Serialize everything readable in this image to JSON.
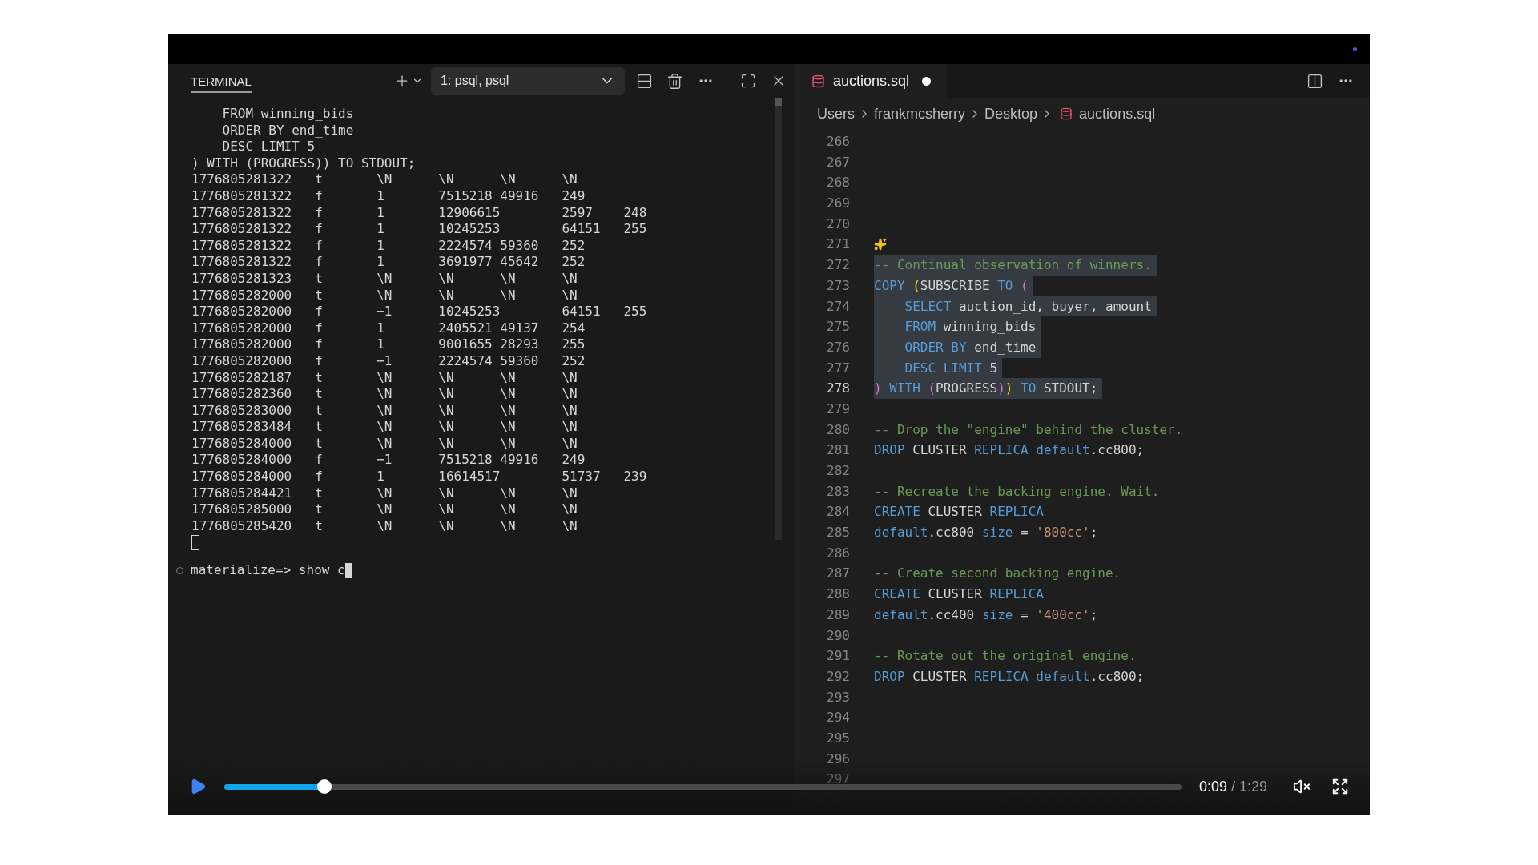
{
  "terminal": {
    "tab": {
      "label": "TERMINAL",
      "selected": true
    },
    "session": "1: psql, psql",
    "output": [
      "    FROM winning_bids",
      "    ORDER BY end_time",
      "    DESC LIMIT 5",
      ") WITH (PROGRESS)) TO STDOUT;",
      "1776805281322\tt\t\\N\t\\N\t\\N\t\\N",
      "1776805281322\tf\t1\t7515218\t49916\t249",
      "1776805281322\tf\t1\t12906615\t2597\t248",
      "1776805281322\tf\t1\t10245253\t64151\t255",
      "1776805281322\tf\t1\t2224574\t59360\t252",
      "1776805281322\tf\t1\t3691977\t45642\t252",
      "1776805281323\tt\t\\N\t\\N\t\\N\t\\N",
      "1776805282000\tt\t\\N\t\\N\t\\N\t\\N",
      "1776805282000\tf\t−1\t10245253\t64151\t255",
      "1776805282000\tf\t1\t2405521\t49137\t254",
      "1776805282000\tf\t1\t9001655\t28293\t255",
      "1776805282000\tf\t−1\t2224574\t59360\t252",
      "1776805282187\tt\t\\N\t\\N\t\\N\t\\N",
      "1776805282360\tt\t\\N\t\\N\t\\N\t\\N",
      "1776805283000\tt\t\\N\t\\N\t\\N\t\\N",
      "1776805283484\tt\t\\N\t\\N\t\\N\t\\N",
      "1776805284000\tt\t\\N\t\\N\t\\N\t\\N",
      "1776805284000\tf\t−1\t7515218\t49916\t249",
      "1776805284000\tf\t1\t16614517\t51737\t239",
      "1776805284421\tt\t\\N\t\\N\t\\N\t\\N",
      "1776805285000\tt\t\\N\t\\N\t\\N\t\\N",
      "1776805285420\tt\t\\N\t\\N\t\\N\t\\N"
    ],
    "prompt": "materialize=> show c"
  },
  "editor": {
    "tab": {
      "label": "auctions.sql",
      "dirty": true
    },
    "breadcrumb": [
      "Users",
      "frankmcsherry",
      "Desktop",
      "auctions.sql"
    ],
    "lines": [
      {
        "number": "266",
        "current": false
      },
      {
        "number": "267",
        "current": false
      },
      {
        "number": "268",
        "current": false
      },
      {
        "number": "269",
        "current": false
      },
      {
        "number": "270",
        "current": false
      },
      {
        "number": "271",
        "current": false,
        "code_action": true
      },
      {
        "number": "272",
        "tokens": [
          {
            "text": "-- Continual observation of winners.",
            "kind": "comment"
          }
        ],
        "highlighted": true,
        "current": false
      },
      {
        "number": "273",
        "tokens": [
          {
            "text": "COPY ",
            "kind": "keyword"
          },
          {
            "text": "(",
            "kind": "paren1"
          },
          {
            "text": "SUBSCRIBE ",
            "kind": "plain"
          },
          {
            "text": "TO ",
            "kind": "keyword"
          },
          {
            "text": "(",
            "kind": "paren2"
          }
        ],
        "highlighted": true,
        "current": false
      },
      {
        "number": "274",
        "tokens": [
          {
            "text": "    SELECT ",
            "kind": "keyword"
          },
          {
            "text": "auction_id, buyer, amount",
            "kind": "plain"
          }
        ],
        "highlighted": true,
        "current": false
      },
      {
        "number": "275",
        "tokens": [
          {
            "text": "    FROM ",
            "kind": "keyword"
          },
          {
            "text": "winning_bids",
            "kind": "plain"
          }
        ],
        "highlighted": true,
        "current": false
      },
      {
        "number": "276",
        "tokens": [
          {
            "text": "    ORDER BY ",
            "kind": "keyword"
          },
          {
            "text": "end_time",
            "kind": "plain"
          }
        ],
        "highlighted": true,
        "current": false
      },
      {
        "number": "277",
        "tokens": [
          {
            "text": "    DESC LIMIT ",
            "kind": "keyword"
          },
          {
            "text": "5",
            "kind": "plain"
          }
        ],
        "highlighted": true,
        "current": false
      },
      {
        "number": "278",
        "tokens": [
          {
            "text": ") ",
            "kind": "paren2"
          },
          {
            "text": "WITH ",
            "kind": "keyword"
          },
          {
            "text": "(",
            "kind": "paren2"
          },
          {
            "text": "PROGRESS",
            "kind": "plain"
          },
          {
            "text": ")",
            "kind": "paren2"
          },
          {
            "text": ") ",
            "kind": "paren1"
          },
          {
            "text": "TO ",
            "kind": "keyword"
          },
          {
            "text": "STDOUT;",
            "kind": "plain"
          }
        ],
        "highlighted": true,
        "current": true
      },
      {
        "number": "279",
        "current": false
      },
      {
        "number": "280",
        "tokens": [
          {
            "text": "-- Drop the \"engine\" behind the cluster.",
            "kind": "comment"
          }
        ],
        "highlighted": false,
        "current": false
      },
      {
        "number": "281",
        "tokens": [
          {
            "text": "DROP ",
            "kind": "keyword"
          },
          {
            "text": "CLUSTER ",
            "kind": "plain"
          },
          {
            "text": "REPLICA default",
            "kind": "keyword"
          },
          {
            "text": ".cc800;",
            "kind": "plain"
          }
        ],
        "highlighted": false,
        "current": false
      },
      {
        "number": "282",
        "current": false
      },
      {
        "number": "283",
        "tokens": [
          {
            "text": "-- Recreate the backing engine. Wait.",
            "kind": "comment"
          }
        ],
        "highlighted": false,
        "current": false
      },
      {
        "number": "284",
        "tokens": [
          {
            "text": "CREATE ",
            "kind": "keyword"
          },
          {
            "text": "CLUSTER ",
            "kind": "plain"
          },
          {
            "text": "REPLICA",
            "kind": "keyword"
          }
        ],
        "highlighted": false,
        "current": false
      },
      {
        "number": "285",
        "tokens": [
          {
            "text": "default",
            "kind": "keyword"
          },
          {
            "text": ".cc800 ",
            "kind": "plain"
          },
          {
            "text": "size ",
            "kind": "keyword"
          },
          {
            "text": "= ",
            "kind": "plain"
          },
          {
            "text": "'800cc'",
            "kind": "string"
          },
          {
            "text": ";",
            "kind": "plain"
          }
        ],
        "highlighted": false,
        "current": false
      },
      {
        "number": "286",
        "current": false
      },
      {
        "number": "287",
        "tokens": [
          {
            "text": "-- Create second backing engine.",
            "kind": "comment"
          }
        ],
        "highlighted": false,
        "current": false
      },
      {
        "number": "288",
        "tokens": [
          {
            "text": "CREATE ",
            "kind": "keyword"
          },
          {
            "text": "CLUSTER ",
            "kind": "plain"
          },
          {
            "text": "REPLICA",
            "kind": "keyword"
          }
        ],
        "highlighted": false,
        "current": false
      },
      {
        "number": "289",
        "tokens": [
          {
            "text": "default",
            "kind": "keyword"
          },
          {
            "text": ".cc400 ",
            "kind": "plain"
          },
          {
            "text": "size ",
            "kind": "keyword"
          },
          {
            "text": "= ",
            "kind": "plain"
          },
          {
            "text": "'400cc'",
            "kind": "string"
          },
          {
            "text": ";",
            "kind": "plain"
          }
        ],
        "highlighted": false,
        "current": false
      },
      {
        "number": "290",
        "current": false
      },
      {
        "number": "291",
        "tokens": [
          {
            "text": "-- Rotate out the original engine.",
            "kind": "comment"
          }
        ],
        "highlighted": false,
        "current": false
      },
      {
        "number": "292",
        "tokens": [
          {
            "text": "DROP ",
            "kind": "keyword"
          },
          {
            "text": "CLUSTER ",
            "kind": "plain"
          },
          {
            "text": "REPLICA default",
            "kind": "keyword"
          },
          {
            "text": ".cc800;",
            "kind": "plain"
          }
        ],
        "highlighted": false,
        "current": false
      },
      {
        "number": "293",
        "current": false
      },
      {
        "number": "294",
        "current": false
      },
      {
        "number": "295",
        "current": false
      },
      {
        "number": "296",
        "current": false
      },
      {
        "number": "297",
        "current": false
      }
    ]
  },
  "player": {
    "level": 0.105,
    "elapsed": "0:09",
    "duration": "/ 1:29"
  }
}
